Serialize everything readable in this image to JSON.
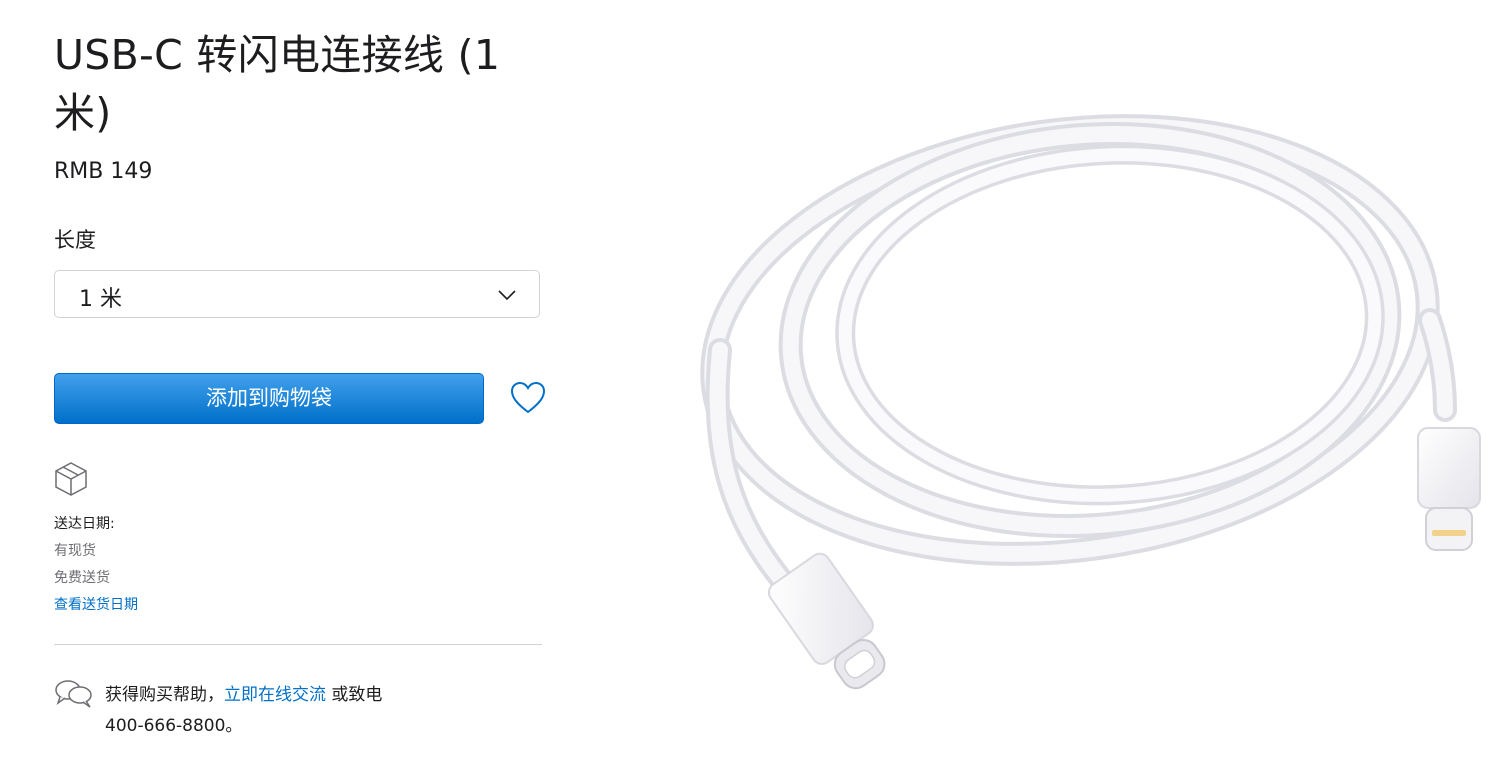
{
  "product": {
    "title": "USB-C 转闪电连接线 (1 米)",
    "price": "RMB 149",
    "image_alt": "USB-C to Lightning cable"
  },
  "length": {
    "label": "长度",
    "selected": "1 米"
  },
  "cart": {
    "add_label": "添加到购物袋"
  },
  "shipping": {
    "heading": "送达日期:",
    "availability": "有现货",
    "free_shipping": "免费送货",
    "check_link": "查看送货日期"
  },
  "help": {
    "prefix": "获得购买帮助，",
    "chat_link": "立即在线交流",
    "middle": " 或致电",
    "phone": "400-666-8800。"
  },
  "colors": {
    "accent": "#0070c9",
    "button_top": "#42a1ec",
    "button_bottom": "#0070c9",
    "text": "#1d1d1f",
    "muted": "#6e6e73"
  },
  "icons": [
    "chevron-down-icon",
    "heart-icon",
    "box-icon",
    "chat-bubbles-icon"
  ]
}
